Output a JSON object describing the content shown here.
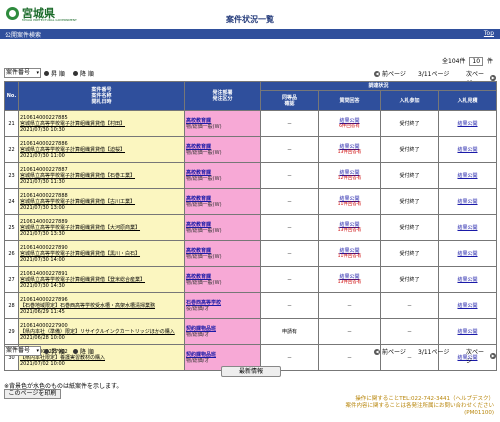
{
  "header": {
    "logo_text": "宮城県",
    "logo_sub": "MIYAGI PREFECTURAL GOVERNMENT",
    "title": "案件状況一覧"
  },
  "bar": {
    "left": "公開案件検索",
    "right": "Top"
  },
  "count": {
    "prefix": "全104件",
    "per_page": "10",
    "suffix": "件"
  },
  "controls": {
    "sort_select": "案件番号",
    "radio_asc": "昇 順",
    "radio_desc": "降 順",
    "prev": "前ページ",
    "page": "3/11ページ",
    "next": "次ページ"
  },
  "table": {
    "headers": {
      "no": "No.",
      "case": "案件番号\n案件名称\n開札日時",
      "dept": "発注部署\n発注区分",
      "status_group": "調達状況",
      "equiv": "同等品\n確認",
      "question": "質問回答",
      "bid": "入札参加",
      "result": "入札見積"
    },
    "rows": [
      {
        "no": "21",
        "id": "210614000227885",
        "name": "宮城県立高等学校電子計算組織賃貸借【村田】",
        "date": "2021/07/30 10:30",
        "dept": "高校教育課",
        "kubun": "物/総価一般(W)",
        "equiv": "－",
        "q": "結果公開",
        "q_note": "6件回答有",
        "bid": "受付終了",
        "result": "結果公開"
      },
      {
        "no": "22",
        "id": "210614000227886",
        "name": "宮城県立高等学校電子計算組織賃貸借【迫桜】",
        "date": "2021/07/30 11:00",
        "dept": "高校教育課",
        "kubun": "物/総価一般(W)",
        "equiv": "－",
        "q": "結果公開",
        "q_note": "13件回答有",
        "bid": "受付終了",
        "result": "結果公開"
      },
      {
        "no": "23",
        "id": "210614000227887",
        "name": "宮城県立高等学校電子計算組織賃貸借【石巻工業】",
        "date": "2021/07/30 11:30",
        "dept": "高校教育課",
        "kubun": "物/総価一般(W)",
        "equiv": "－",
        "q": "結果公開",
        "q_note": "12件回答有",
        "bid": "受付終了",
        "result": "結果公開"
      },
      {
        "no": "24",
        "id": "210614000227888",
        "name": "宮城県立高等学校電子計算組織賃貸借【古川工業】",
        "date": "2021/07/30 13:00",
        "dept": "高校教育課",
        "kubun": "物/総価一般(W)",
        "equiv": "－",
        "q": "結果公開",
        "q_note": "11件回答有",
        "bid": "受付終了",
        "result": "結果公開"
      },
      {
        "no": "25",
        "id": "210614000227889",
        "name": "宮城県立高等学校電子計算組織賃貸借【大河原商業】",
        "date": "2021/07/30 13:30",
        "dept": "高校教育課",
        "kubun": "物/総価一般(W)",
        "equiv": "－",
        "q": "結果公開",
        "q_note": "13件回答有",
        "bid": "受付終了",
        "result": "結果公開"
      },
      {
        "no": "26",
        "id": "210614000227890",
        "name": "宮城県立高等学校電子計算組織賃貸借【黒川・白石】",
        "date": "2021/07/30 14:00",
        "dept": "高校教育課",
        "kubun": "物/総価一般(W)",
        "equiv": "－",
        "q": "結果公開",
        "q_note": "11件回答有",
        "bid": "受付終了",
        "result": "結果公開"
      },
      {
        "no": "27",
        "id": "210614000227891",
        "name": "宮城県立高等学校電子計算組織賃貸借【登米総合産業】",
        "date": "2021/07/30 14:30",
        "dept": "高校教育課",
        "kubun": "物/総価一般(W)",
        "equiv": "－",
        "q": "結果公開",
        "q_note": "13件回答有",
        "bid": "受付終了",
        "result": "結果公開"
      },
      {
        "no": "28",
        "id": "210614000227896",
        "name": "【石巻地域限定】石巻西高等学校受水槽・高架水槽清掃業務",
        "date": "2021/06/29 11:45",
        "dept": "石巻西高等学校",
        "kubun": "役/総価/オ",
        "equiv": "－",
        "q": "－",
        "q_note": "",
        "bid": "－",
        "result": "結果公開"
      },
      {
        "no": "29",
        "id": "210614000227900",
        "name": "【県内本社（準備）限定】リサイクルインクカートリッジほかの購入",
        "date": "2021/06/28 10:00",
        "dept": "契約課物品班",
        "kubun": "物/総価/オ",
        "equiv": "申請有",
        "q": "－",
        "q_note": "",
        "bid": "－",
        "result": "結果公開"
      },
      {
        "no": "30",
        "id": "210614000227902",
        "name": "【県内本社限定】養護実習教材の購入",
        "date": "2021/07/02 10:00",
        "dept": "契約課物品班",
        "kubun": "物/総価/オ",
        "equiv": "－",
        "q": "－",
        "q_note": "",
        "bid": "－",
        "result": "結果公開"
      }
    ]
  },
  "buttons": {
    "latest": "最新情報",
    "print": "このページを印刷"
  },
  "footnote": "※背景色が水色のものは紙案件を示します。",
  "contact": {
    "line1": "操作に関することTEL:022-742-3441（ヘルプデスク）",
    "line2": "案件内容に関することは各発注所属にお問い合わせください",
    "line3": "(PM01100)"
  },
  "colors": {
    "header_bar": "#2f4f9c",
    "name_bg": "#fbf6c0",
    "dept_bg": "#f7a9d6",
    "accent": "#cc0000"
  }
}
